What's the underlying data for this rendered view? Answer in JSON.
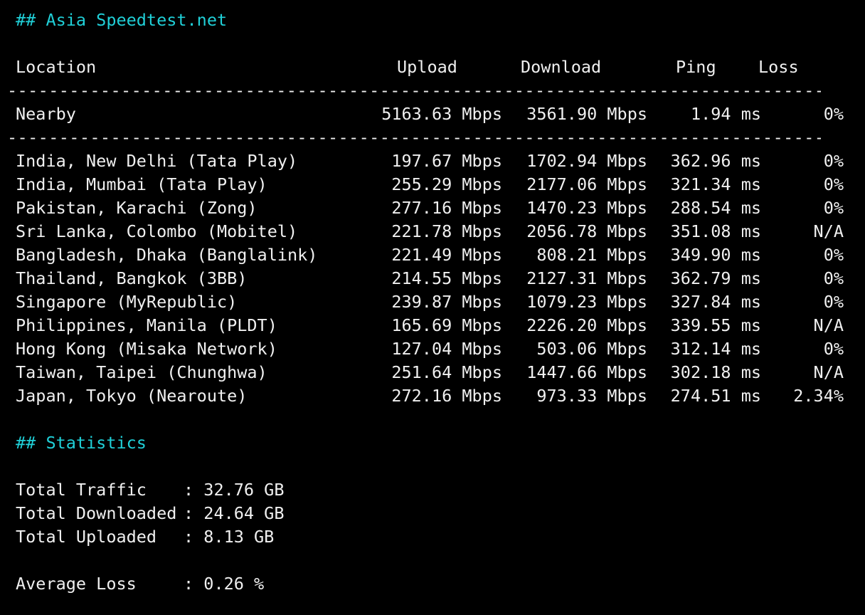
{
  "asia_heading": "## Asia Speedtest.net",
  "table": {
    "headers": {
      "location": "Location",
      "upload": "Upload",
      "download": "Download",
      "ping": "Ping",
      "loss": "Loss"
    },
    "separator": "------------------------------------------------------------------------------------------",
    "nearby": {
      "location": "Nearby",
      "upload": "5163.63 Mbps",
      "download": "3561.90 Mbps",
      "ping": "1.94 ms",
      "loss": "0%"
    },
    "rows": [
      {
        "location": "India, New Delhi (Tata Play)",
        "upload": "197.67 Mbps",
        "download": "1702.94 Mbps",
        "ping": "362.96 ms",
        "loss": "0%"
      },
      {
        "location": "India, Mumbai (Tata Play)",
        "upload": "255.29 Mbps",
        "download": "2177.06 Mbps",
        "ping": "321.34 ms",
        "loss": "0%"
      },
      {
        "location": "Pakistan, Karachi (Zong)",
        "upload": "277.16 Mbps",
        "download": "1470.23 Mbps",
        "ping": "288.54 ms",
        "loss": "0%"
      },
      {
        "location": "Sri Lanka, Colombo (Mobitel)",
        "upload": "221.78 Mbps",
        "download": "2056.78 Mbps",
        "ping": "351.08 ms",
        "loss": "N/A"
      },
      {
        "location": "Bangladesh, Dhaka (Banglalink)",
        "upload": "221.49 Mbps",
        "download": "808.21 Mbps",
        "ping": "349.90 ms",
        "loss": "0%"
      },
      {
        "location": "Thailand, Bangkok (3BB)",
        "upload": "214.55 Mbps",
        "download": "2127.31 Mbps",
        "ping": "362.79 ms",
        "loss": "0%"
      },
      {
        "location": "Singapore (MyRepublic)",
        "upload": "239.87 Mbps",
        "download": "1079.23 Mbps",
        "ping": "327.84 ms",
        "loss": "0%"
      },
      {
        "location": "Philippines, Manila (PLDT)",
        "upload": "165.69 Mbps",
        "download": "2226.20 Mbps",
        "ping": "339.55 ms",
        "loss": "N/A"
      },
      {
        "location": "Hong Kong (Misaka Network)",
        "upload": "127.04 Mbps",
        "download": "503.06 Mbps",
        "ping": "312.14 ms",
        "loss": "0%"
      },
      {
        "location": "Taiwan, Taipei (Chunghwa)",
        "upload": "251.64 Mbps",
        "download": "1447.66 Mbps",
        "ping": "302.18 ms",
        "loss": "N/A"
      },
      {
        "location": "Japan, Tokyo (Nearoute)",
        "upload": "272.16 Mbps",
        "download": "973.33 Mbps",
        "ping": "274.51 ms",
        "loss": "2.34%"
      }
    ]
  },
  "stats_heading": "## Statistics",
  "statistics": {
    "total_traffic": {
      "label": "Total Traffic",
      "value": ": 32.76 GB"
    },
    "total_downloaded": {
      "label": "Total Downloaded",
      "value": ": 24.64 GB"
    },
    "total_uploaded": {
      "label": "Total Uploaded",
      "value": ": 8.13 GB"
    },
    "average_loss": {
      "label": "Average Loss",
      "value": ": 0.26 %"
    }
  },
  "colors": {
    "background": "#000000",
    "text": "#f0f0f0",
    "heading": "#20d0d8"
  }
}
